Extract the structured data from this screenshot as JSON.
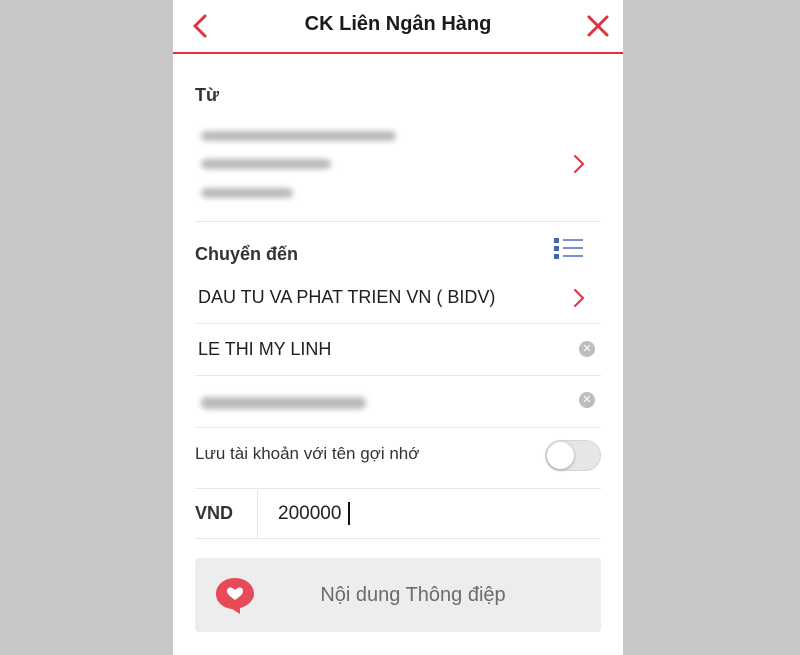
{
  "header": {
    "title": "CK Liên Ngân Hàng",
    "accent_color": "#e0313d",
    "back_icon": "chevron-left-icon",
    "close_icon": "close-icon"
  },
  "from": {
    "label": "Từ"
  },
  "to": {
    "label": "Chuyển đến",
    "bank": "DAU TU VA PHAT TRIEN VN ( BIDV)",
    "recipient_name": "LE THI MY LINH",
    "list_icon": "list-icon"
  },
  "save_account": {
    "label": "Lưu tài khoản với tên gợi nhớ",
    "enabled": false
  },
  "amount": {
    "currency": "VND",
    "value": "200000"
  },
  "message": {
    "placeholder": "Nội dung Thông điệp",
    "icon": "chat-heart-icon"
  }
}
